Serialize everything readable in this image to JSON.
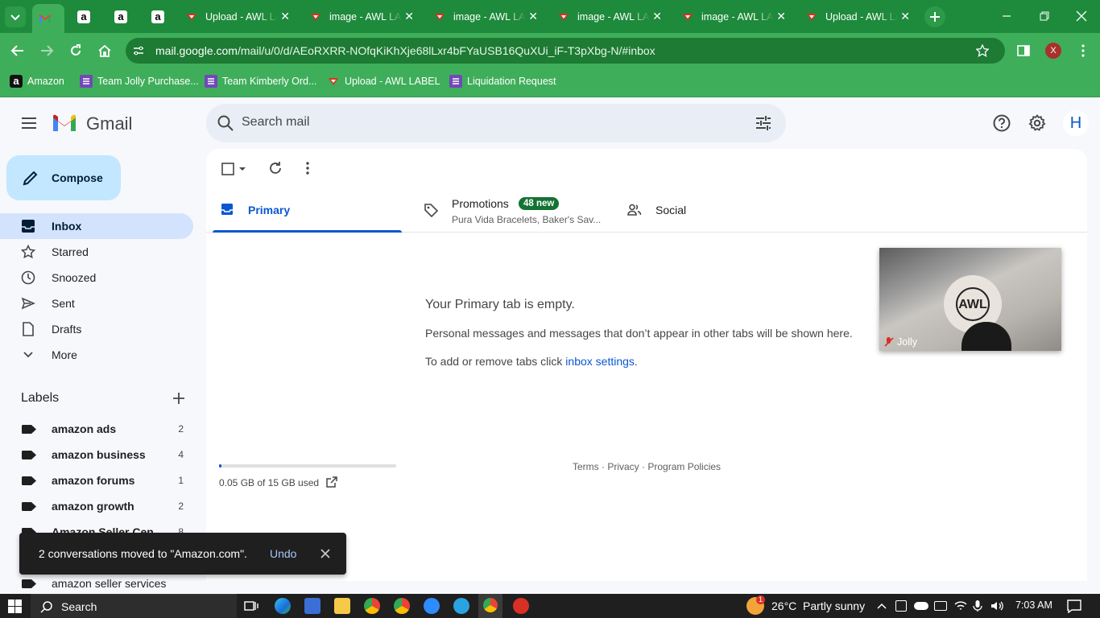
{
  "browser": {
    "tabs": [
      {
        "title": "",
        "favicon": "gmail-icon",
        "active": true
      },
      {
        "title": "",
        "favicon": "amazon-icon"
      },
      {
        "title": "",
        "favicon": "amazon-icon"
      },
      {
        "title": "",
        "favicon": "amazon-icon"
      },
      {
        "title": "Upload - AWL LABEL",
        "favicon": "awl-icon"
      },
      {
        "title": "image - AWL LABEL",
        "favicon": "awl-icon"
      },
      {
        "title": "image - AWL LABEL",
        "favicon": "awl-icon"
      },
      {
        "title": "image - AWL LABEL",
        "favicon": "awl-icon"
      },
      {
        "title": "image - AWL LABEL",
        "favicon": "awl-icon"
      },
      {
        "title": "Upload - AWL LABEL",
        "favicon": "awl-icon"
      }
    ],
    "close_glyph": "✕",
    "url_host": "mail.google.com",
    "url_path": "/mail/u/0/d/AEoRXRR-NOfqKiKhXje68lLxr4bFYaUSB16QuXUi_iF-T3pXbg-N/#inbox",
    "profile_letter": "X",
    "bookmarks": [
      {
        "label": "Amazon",
        "icon": "amazon-icon"
      },
      {
        "label": "Team Jolly Purchase...",
        "icon": "list-icon"
      },
      {
        "label": "Team Kimberly Ord...",
        "icon": "list-icon"
      },
      {
        "label": "Upload - AWL LABEL",
        "icon": "awl-icon"
      },
      {
        "label": "Liquidation Request",
        "icon": "list-icon"
      }
    ],
    "theme_color": "#3fae5a"
  },
  "gmail": {
    "brand": "Gmail",
    "search_placeholder": "Search mail",
    "account_letter": "H",
    "compose_label": "Compose",
    "nav": [
      {
        "label": "Inbox",
        "icon": "inbox-icon",
        "active": true
      },
      {
        "label": "Starred",
        "icon": "star-icon"
      },
      {
        "label": "Snoozed",
        "icon": "clock-icon"
      },
      {
        "label": "Sent",
        "icon": "send-icon"
      },
      {
        "label": "Drafts",
        "icon": "draft-icon"
      },
      {
        "label": "More",
        "icon": "chevron-down-icon"
      }
    ],
    "labels_heading": "Labels",
    "labels": [
      {
        "name": "amazon ads",
        "count": "2"
      },
      {
        "name": "amazon business",
        "count": "4"
      },
      {
        "name": "amazon forums",
        "count": "1"
      },
      {
        "name": "amazon growth",
        "count": "2"
      },
      {
        "name": "Amazon Seller Cen...",
        "count": "8"
      },
      {
        "name": "amazon seller services",
        "count": ""
      }
    ],
    "category_tabs": {
      "primary": "Primary",
      "promotions": "Promotions",
      "promotions_badge": "48 new",
      "promotions_snippet": "Pura Vida Bracelets, Baker's Sav...",
      "social": "Social"
    },
    "empty": {
      "title": "Your Primary tab is empty.",
      "line1": "Personal messages and messages that don’t appear in other tabs will be shown here.",
      "line2_prefix": "To add or remove tabs click ",
      "line2_link": "inbox settings",
      "line2_suffix": "."
    },
    "storage_text": "0.05 GB of 15 GB used",
    "storage_fraction": 0.0033,
    "footer": {
      "terms": "Terms",
      "privacy": "Privacy",
      "policies": "Program Policies",
      "sep": " · "
    },
    "video_name": "Jolly",
    "video_logo": "AWL",
    "toast": {
      "message": "2 conversations moved to \"Amazon.com\".",
      "undo": "Undo"
    }
  },
  "taskbar": {
    "search_label": "Search",
    "weather": "26°C  Partly sunny",
    "weather_badge": "1",
    "time": "7:03 AM"
  }
}
